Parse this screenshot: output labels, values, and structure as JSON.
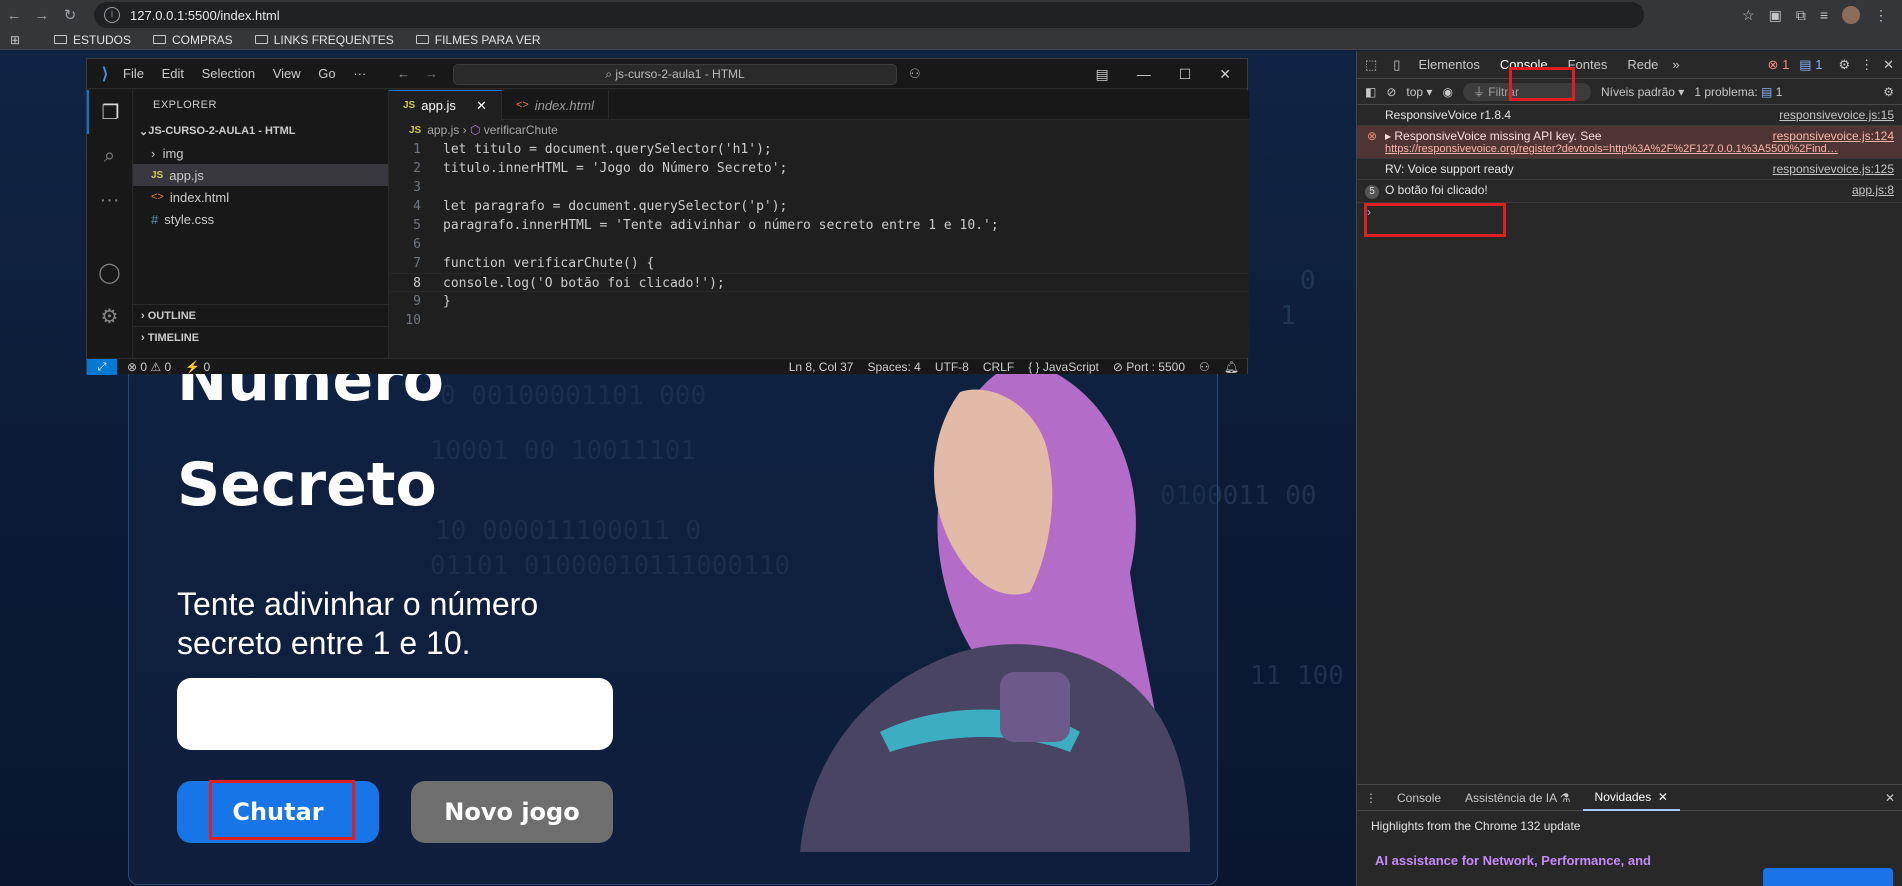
{
  "browser": {
    "url": "127.0.0.1:5500/index.html",
    "bookmarks": [
      "ESTUDOS",
      "COMPRAS",
      "LINKS FREQUENTES",
      "FILMES PARA VER"
    ]
  },
  "page": {
    "title_line1": "Número",
    "title_line2": "Secreto",
    "subtitle": "Tente adivinhar o número secreto entre 1 e 10.",
    "guess_button": "Chutar",
    "new_game_button": "Novo jogo"
  },
  "vscode": {
    "menu": [
      "File",
      "Edit",
      "Selection",
      "View",
      "Go",
      "···"
    ],
    "search": "js-curso-2-aula1 - HTML",
    "explorer_title": "EXPLORER",
    "project": "JS-CURSO-2-AULA1 - HTML",
    "files": {
      "folder": "img",
      "f1": "app.js",
      "f2": "index.html",
      "f3": "style.css"
    },
    "outline": "OUTLINE",
    "timeline": "TIMELINE",
    "tabs": {
      "t1": "app.js",
      "t2": "index.html"
    },
    "breadcrumb": {
      "file": "app.js",
      "symbol": "verificarChute"
    },
    "code_lines": [
      "let titulo = document.querySelector('h1');",
      "titulo.innerHTML = 'Jogo do Número Secreto';",
      "",
      "let paragrafo = document.querySelector('p');",
      "paragrafo.innerHTML = 'Tente adivinhar o número secreto entre 1 e 10.';",
      "",
      "function verificarChute() {",
      "console.log('O botão foi clicado!');",
      "}",
      ""
    ],
    "line_numbers": [
      "1",
      "2",
      "3",
      "4",
      "5",
      "6",
      "7",
      "8",
      "9",
      "10"
    ],
    "status": {
      "problems": "⊗ 0 ⚠ 0",
      "ports": "⚡ 0",
      "position": "Ln 8, Col 37",
      "spaces": "Spaces: 4",
      "encoding": "UTF-8",
      "eol": "CRLF",
      "language": "{ } JavaScript",
      "port": "⊘ Port : 5500"
    }
  },
  "devtools": {
    "tabs": [
      "Elementos",
      "Console",
      "Fontes",
      "Rede"
    ],
    "errors": "1",
    "messages": "1",
    "context": "top ▾",
    "filter_placeholder": "Filtrar",
    "levels": "Níveis padrão ▾",
    "problems": "1 problema: ",
    "problems_count": "1",
    "logs": [
      {
        "text": "ResponsiveVoice r1.8.4",
        "src": "responsivevoice.js:15"
      },
      {
        "text": "▸ ResponsiveVoice missing API key. See",
        "src": "responsivevoice.js:124",
        "link": "https://responsivevoice.org/register?devtools=http%3A%2F%2F127.0.0.1%3A5500%2Find…"
      },
      {
        "text": "RV: Voice support ready",
        "src": "responsivevoice.js:125"
      },
      {
        "text": "O botão foi clicado!",
        "src": "app.js:8",
        "count": "5"
      }
    ],
    "bottom_tabs": [
      "Console",
      "Assistência de IA",
      "Novidades"
    ],
    "highlights": "Highlights from the Chrome 132 update",
    "ai_text": "AI assistance for Network, Performance, and"
  }
}
